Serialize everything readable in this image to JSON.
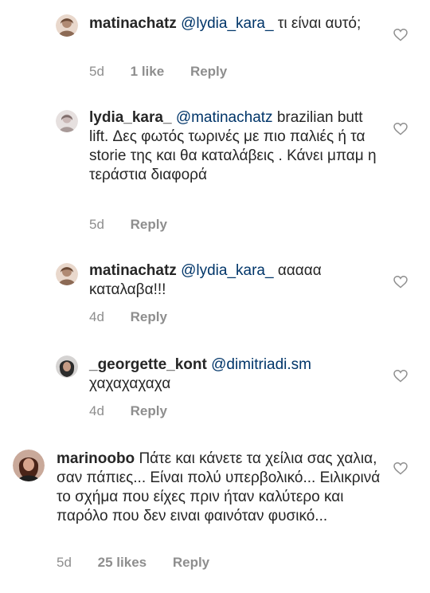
{
  "comments": [
    {
      "username": "matinachatz",
      "mention": "@lydia_kara_",
      "text": " τι είναι αυτό;",
      "time": "5d",
      "likes": "1 like",
      "reply": "Reply",
      "avatar_color": "#b08a73"
    },
    {
      "username": "lydia_kara_",
      "mention": "@matinachatz",
      "text": " brazilian butt lift.  Δες φωτός τωρινές με πιο παλιές ή τα storie της και θα καταλάβεις .  Κάνει μπαμ η τεράστια διαφορά",
      "time": "5d",
      "reply": "Reply",
      "avatar_color": "#c9b7b5"
    },
    {
      "username": "matinachatz",
      "mention": "@lydia_kara_",
      "text": " ααααα καταλαβα!!!",
      "time": "4d",
      "reply": "Reply",
      "avatar_color": "#b08a73"
    },
    {
      "username": "_georgette_kont",
      "mention": "@dimitriadi.sm",
      "text_line2": "χαχαχαχαχα",
      "time": "4d",
      "reply": "Reply",
      "avatar_color": "#2c2c2c"
    },
    {
      "username": "marinoobo",
      "text": " Πάτε και κάνετε τα χείλια σας χαλια, σαν πάπιες... Είναι πολύ υπερβολικό... Ειλικρινά το σχήμα που είχες πριν ήταν καλύτερο και παρόλο που δεν ειναι φαινόταν φυσικό...",
      "time": "5d",
      "likes": "25 likes",
      "reply": "Reply",
      "avatar_color": "#6b3a2e"
    }
  ],
  "colors": {
    "text": "#262626",
    "mention": "#003569",
    "meta": "#8e8e8e"
  },
  "icons": {
    "like": "heart-outline-icon"
  }
}
